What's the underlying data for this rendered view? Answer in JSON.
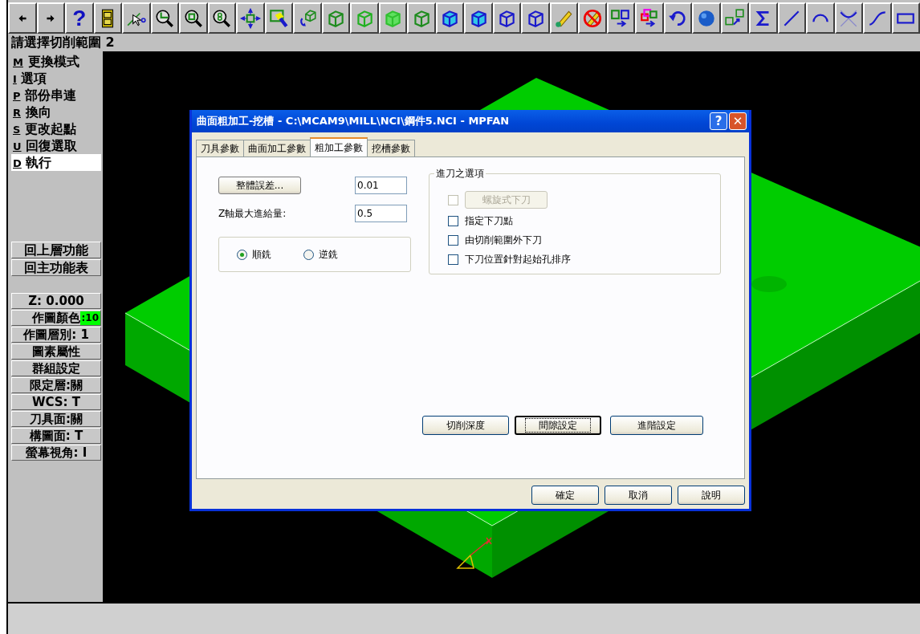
{
  "toolbar": {
    "help_glyph": "?"
  },
  "prompt": "請選擇切削範圍 2",
  "mode_menu": [
    {
      "key": "M",
      "label": "更換模式",
      "selected": false
    },
    {
      "key": "I",
      "label": "選項",
      "selected": false
    },
    {
      "key": "P",
      "label": "部份串連",
      "selected": false
    },
    {
      "key": "R",
      "label": "換向",
      "selected": false
    },
    {
      "key": "S",
      "label": "更改起點",
      "selected": false
    },
    {
      "key": "U",
      "label": "回復選取",
      "selected": false
    },
    {
      "key": "D",
      "label": "執行",
      "selected": true
    }
  ],
  "nav_buttons": [
    "回上層功能",
    "回主功能表"
  ],
  "status_items": [
    {
      "kind": "text",
      "label": "Z:  0.000"
    },
    {
      "kind": "color",
      "label": "作圖顏色",
      "value": ":10",
      "color": "#00ff00"
    },
    {
      "kind": "text",
      "label": "作圖層別: 1"
    },
    {
      "kind": "text",
      "label": "圖素屬性"
    },
    {
      "kind": "text",
      "label": "群組設定"
    },
    {
      "kind": "text",
      "label": "限定層:關"
    },
    {
      "kind": "text",
      "label": "WCS:  T"
    },
    {
      "kind": "text",
      "label": "刀具面:關"
    },
    {
      "kind": "text",
      "label": "構圖面: T"
    },
    {
      "kind": "text",
      "label": "螢幕視角: I"
    }
  ],
  "dialog": {
    "title": "曲面粗加工-挖槽 - C:\\MCAM9\\MILL\\NCI\\鋼件5.NCI - MPFAN",
    "help_glyph": "?",
    "close_glyph": "✕",
    "tabs": [
      {
        "label": "刀具參數",
        "selected": false
      },
      {
        "label": "曲面加工參數",
        "selected": false
      },
      {
        "label": "粗加工參數",
        "selected": true
      },
      {
        "label": "挖槽參數",
        "selected": false
      }
    ],
    "tolerance_button": "整體誤差...",
    "tolerance_value": "0.01",
    "stepdown_label": "Z軸最大進給量:",
    "stepdown_value": "0.5",
    "milling": [
      {
        "label": "順銑",
        "selected": true
      },
      {
        "label": "逆銑",
        "selected": false
      }
    ],
    "entry_group": {
      "title": "進刀之選項",
      "options": [
        {
          "kind": "button",
          "label": "螺旋式下刀",
          "checked": false,
          "disabled": true
        },
        {
          "kind": "check",
          "label": "指定下刀點",
          "checked": false,
          "disabled": false
        },
        {
          "kind": "check",
          "label": "由切削範圍外下刀",
          "checked": false,
          "disabled": false
        },
        {
          "kind": "check",
          "label": "下刀位置針對起始孔排序",
          "checked": false,
          "disabled": false
        }
      ]
    },
    "action_buttons": [
      {
        "label": "切削深度",
        "focused": false
      },
      {
        "label": "間隙設定",
        "focused": true
      },
      {
        "label": "進階設定",
        "focused": false
      }
    ],
    "footer_buttons": [
      "確定",
      "取消",
      "說明"
    ]
  }
}
